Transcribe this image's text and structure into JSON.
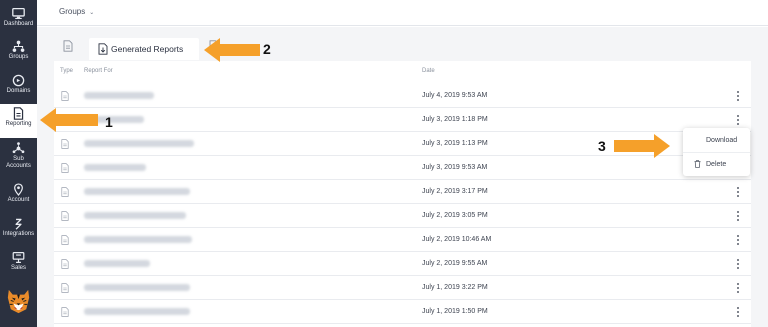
{
  "sidebar": {
    "items": [
      {
        "label": "Dashboard",
        "icon": "monitor-icon",
        "active": false
      },
      {
        "label": "Groups",
        "icon": "hierarchy-icon",
        "active": false
      },
      {
        "label": "Domains",
        "icon": "domains-icon",
        "active": false
      },
      {
        "label": "Reporting",
        "icon": "report-icon",
        "active": true
      },
      {
        "label": "Sub Accounts",
        "icon": "sub-accounts-icon",
        "active": false
      },
      {
        "label": "Account",
        "icon": "location-pin-icon",
        "active": false
      },
      {
        "label": "Integrations",
        "icon": "integrations-icon",
        "active": false
      },
      {
        "label": "Sales",
        "icon": "sales-icon",
        "active": false
      }
    ],
    "mascot_icon": "tiger-mascot-icon"
  },
  "header": {
    "dropdown_label": "Groups",
    "dropdown_icon": "chevron-down-icon"
  },
  "tabs": {
    "active_label": "Generated Reports"
  },
  "table": {
    "headers": {
      "type": "Type",
      "report_for": "Report For",
      "date": "Date"
    },
    "rows": [
      {
        "date": "July 4, 2019 9:53 AM"
      },
      {
        "date": "July 3, 2019 1:18 PM"
      },
      {
        "date": "July 3, 2019 1:13 PM"
      },
      {
        "date": "July 3, 2019 9:53 AM"
      },
      {
        "date": "July 2, 2019 3:17 PM"
      },
      {
        "date": "July 2, 2019 3:05 PM"
      },
      {
        "date": "July 2, 2019 10:46 AM"
      },
      {
        "date": "July 2, 2019 9:55 AM"
      },
      {
        "date": "July 1, 2019 3:22 PM"
      },
      {
        "date": "July 1, 2019 1:50 PM"
      }
    ]
  },
  "menu": {
    "download": "Download",
    "delete": "Delete",
    "delete_icon": "trash-icon"
  },
  "annotations": {
    "one": "1",
    "two": "2",
    "three": "3",
    "arrow_color": "#f5a02a"
  },
  "colors": {
    "sidebar_bg": "#2b3140",
    "content_bg": "#f4f5f7",
    "accent_arrow": "#f5a02a"
  }
}
